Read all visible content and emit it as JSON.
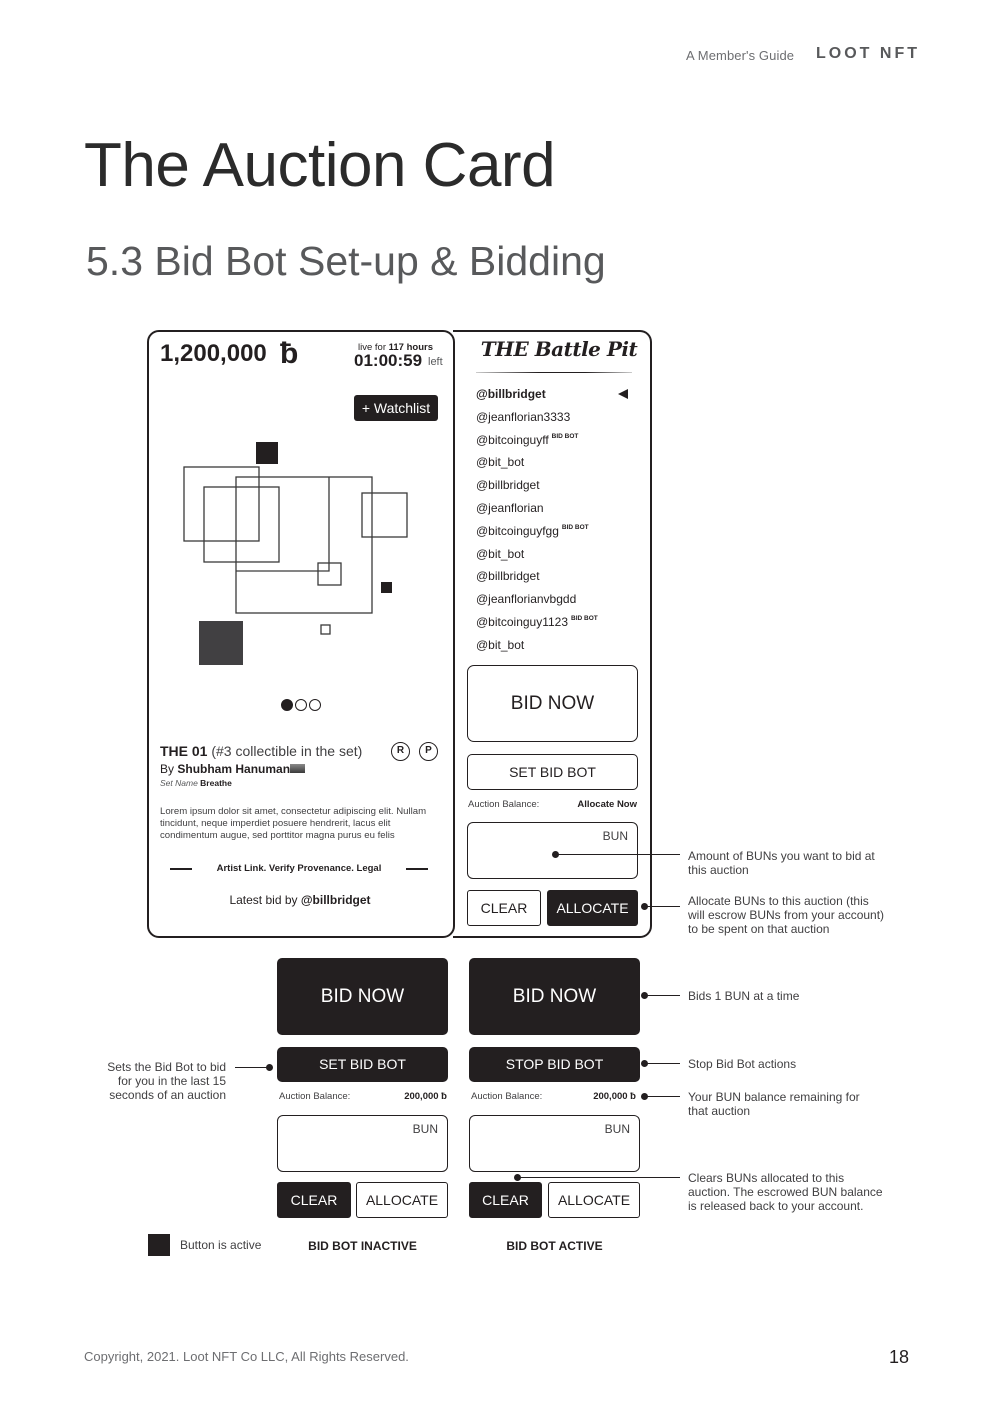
{
  "header": {
    "guide_label": "A Member's Guide",
    "brand": "LOOT NFT"
  },
  "page_title": "The Auction Card",
  "section_title": "5.3 Bid Bot Set-up & Bidding",
  "auction_card": {
    "price": "1,200,000",
    "currency_symbol": "ƀ",
    "live_for_prefix": "live for",
    "live_for_value": "117 hours",
    "countdown": "01:00:59",
    "countdown_suffix": "left",
    "watchlist_label": "+ Watchlist",
    "carousel": {
      "count": 3,
      "active_index": 0
    },
    "title_bold": "THE 01",
    "title_sub": "(#3 collectible in the set)",
    "badges": [
      "R",
      "P"
    ],
    "artist_prefix": "By",
    "artist_name": "Shubham Hanuman",
    "set_name_label": "Set Name",
    "set_name": "Breathe",
    "description": "Lorem ipsum dolor sit amet, consectetur adipiscing elit. Nullam tincidunt, neque imperdiet posuere hendrerit, lacus elit condimentum augue, sed porttitor magna purus eu felis",
    "links_text": "Artist Link. Verify Provenance. Legal",
    "latest_bid_prefix": "Latest bid by",
    "latest_bid_user": "@billbridget"
  },
  "battle_pit": {
    "title": "THE Battle Pit",
    "bidders": [
      {
        "name": "@billbridget",
        "bold": true,
        "bot": false,
        "current": true
      },
      {
        "name": "@jeanflorian3333",
        "bold": false,
        "bot": false
      },
      {
        "name": "@bitcoinguyff",
        "bold": false,
        "bot": true
      },
      {
        "name": "@bit_bot",
        "bold": false,
        "bot": false
      },
      {
        "name": "@billbridget",
        "bold": false,
        "bot": false
      },
      {
        "name": "@jeanflorian",
        "bold": false,
        "bot": false
      },
      {
        "name": "@bitcoinguyfgg",
        "bold": false,
        "bot": true
      },
      {
        "name": "@bit_bot",
        "bold": false,
        "bot": false
      },
      {
        "name": "@billbridget",
        "bold": false,
        "bot": false
      },
      {
        "name": "@jeanflorianvbgdd",
        "bold": false,
        "bot": false
      },
      {
        "name": "@bitcoinguy1123",
        "bold": false,
        "bot": true
      },
      {
        "name": "@bit_bot",
        "bold": false,
        "bot": false
      }
    ],
    "bot_tag": "BID BOT",
    "bid_now_label": "BID NOW",
    "set_bid_bot_label": "SET BID BOT",
    "auction_balance_label": "Auction Balance:",
    "auction_balance_value": "Allocate Now",
    "bun_label": "BUN",
    "clear_label": "CLEAR",
    "allocate_label": "ALLOCATE"
  },
  "states": {
    "inactive": {
      "caption": "BID BOT INACTIVE",
      "bid_now_label": "BID NOW",
      "bot_label": "SET BID BOT",
      "auction_balance_label": "Auction Balance:",
      "auction_balance_value": "200,000 ƀ",
      "bun_label": "BUN",
      "clear_label": "CLEAR",
      "allocate_label": "ALLOCATE"
    },
    "active": {
      "caption": "BID BOT ACTIVE",
      "bid_now_label": "BID NOW",
      "bot_label": "STOP BID BOT",
      "auction_balance_label": "Auction Balance:",
      "auction_balance_value": "200,000 ƀ",
      "bun_label": "BUN",
      "clear_label": "CLEAR",
      "allocate_label": "ALLOCATE"
    }
  },
  "annotations": {
    "amount": "Amount of BUNs you want to bid at this auction",
    "allocate": "Allocate BUNs to this auction (this will escrow BUNs from your account) to be spent on that auction",
    "bid_now": "Bids 1 BUN at a time",
    "set_bid_bot": "Sets the Bid Bot to bid for you in the last 15 seconds of an auction",
    "stop_bid_bot": "Stop Bid Bot actions",
    "balance": "Your BUN balance remaining for that auction",
    "clear": "Clears BUNs allocated to this auction. The escrowed BUN balance is released back to your account."
  },
  "legend": {
    "active_label": "Button is active"
  },
  "footer": {
    "copyright": "Copyright, 2021. Loot NFT Co LLC, All Rights Reserved.",
    "page_number": "18"
  }
}
